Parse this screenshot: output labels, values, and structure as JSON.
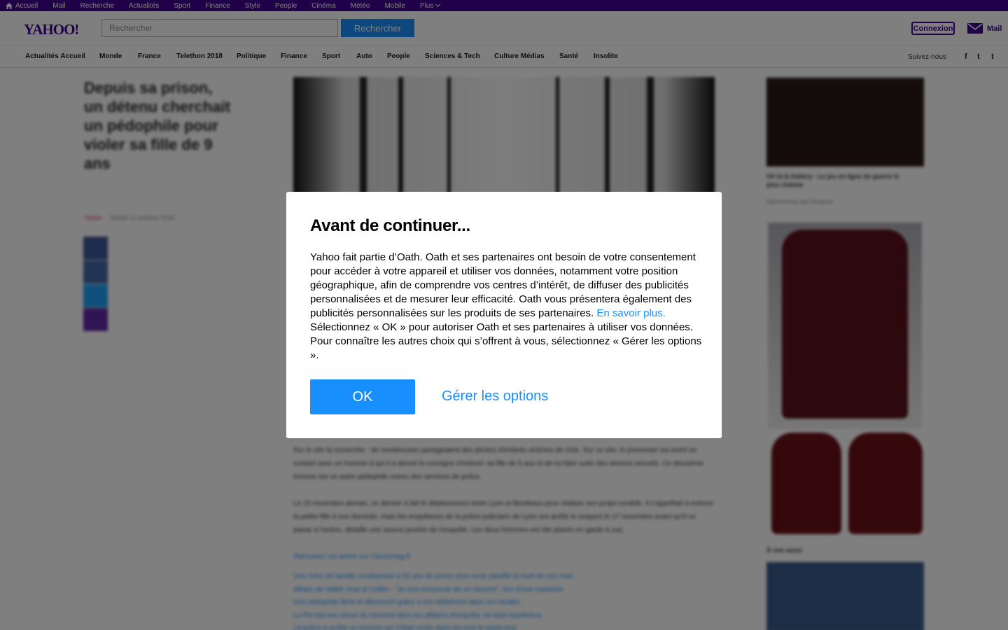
{
  "topbar": {
    "items": [
      "Accueil",
      "Mail",
      "Recherche",
      "Actualités",
      "Sport",
      "Finance",
      "Style",
      "People",
      "Cinéma",
      "Météo",
      "Mobile",
      "Plus"
    ]
  },
  "header": {
    "logo": "YAHOO!",
    "search_placeholder": "Rechercher",
    "search_button": "Rechercher",
    "connexion": "Connexion",
    "mail": "Mail"
  },
  "nav": {
    "items": [
      "Actualités Accueil",
      "Monde",
      "France",
      "Telethon 2018",
      "Politique",
      "Finance",
      "Sport",
      "Auto",
      "People",
      "Sciences & Tech",
      "Culture Médias",
      "Santé",
      "Insolite"
    ],
    "follow": "Suivez-nous",
    "social": [
      "f",
      "t",
      "t"
    ]
  },
  "article": {
    "title": "Depuis sa prison, un détenu cherchait un pédophile pour violer sa fille de 9 ans",
    "source": "Yahoo",
    "author": "Media",
    "date": "11 octobre 2018",
    "para1": "Sur le site la recherche : de nombreuses partageaient des photos d'enfants victimes de viols. Sur ce site, le prisonnier est entré en contact avec un homme à qui il a donné la consigne d'enlever sa fille de 9 ans et de lui faire subir des sévices sexuels. Ce deuxième homme est un autre pédophile connu des services de police.",
    "para2": "Le 15 novembre dernier, ce dernier a fait le déplacement entre Lyon et Bordeaux pour réaliser son projet sordide. Il s'apprêtait à enlever la petite fille à son domicile, mais les enquêteurs de la police judiciaire de Lyon ont arrêté le suspect le 17 novembre avant qu'il ne passe à l'action, détaille une source proche de l'enquête. Les deux hommes ont été placés en garde à vue.",
    "link1": "Retrouvez cet article sur Closermag.fr",
    "related": [
      "Une mère de famille condamnée à 55 ans de prison pour avoir planifié la mort de son mari",
      "Affaire de l'abbé Jean & Cellier : \"Je suis innocente de ce meurtre\", lors d'une expertise",
      "Une pédophile filmé et découvert grâce à son téléphone dans son lavabo",
      "La Pie fait son retour du moment dans les affaires d'enquête, lui était mystérieux",
      "La police a arrêté un homme qui s'était rendu dans les bois le week-end"
    ]
  },
  "sidebar": {
    "ad1_caption": "Oh là là Gallery : Le jeu en ligne de guerre le plus réaliste",
    "ad1_sub": "Sponsorisé par Amazon",
    "label": "À voir aussi"
  },
  "modal": {
    "title": "Avant de continuer...",
    "text_before_link": "Yahoo fait partie d’Oath. Oath et ses partenaires ont besoin de votre consentement pour accéder à votre appareil et utiliser vos données, notamment votre position géographique, afin de comprendre vos centres d’intérêt, de diffuser des publicités personnalisées et de mesurer leur efficacité. Oath vous présentera également des publicités personnalisées sur les produits de ses partenaires.",
    "link": "En savoir plus.",
    "text_after_link": "Sélectionnez « OK » pour autoriser Oath et ses partenaires à utiliser vos données. Pour connaître les autres choix qui s’offrent à vous, sélectionnez « Gérer les options ».",
    "ok": "OK",
    "manage": "Gérer les options"
  },
  "colors": {
    "brand_purple": "#400090",
    "accent_blue": "#188fff"
  }
}
